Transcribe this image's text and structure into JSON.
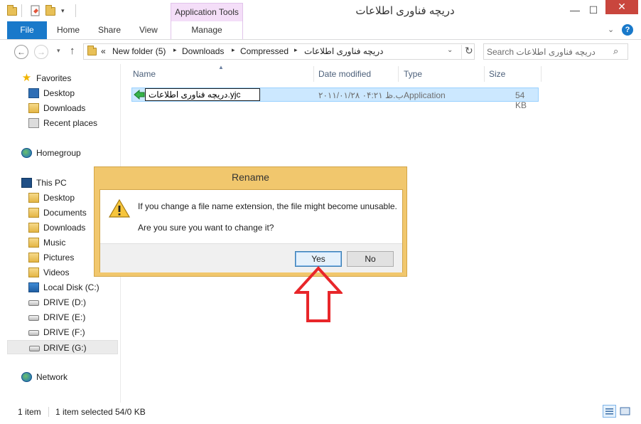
{
  "window": {
    "title": "دریچه فناوری اطلاعات",
    "contextual_tab": "Application Tools"
  },
  "ribbon": {
    "tabs": [
      "File",
      "Home",
      "Share",
      "View",
      "Manage"
    ]
  },
  "address": {
    "overflow": "«",
    "crumbs": [
      "New folder (5)",
      "Downloads",
      "Compressed",
      "دریچه فناوری اطلاعات"
    ],
    "search_placeholder": "Search دریچه فناوری اطلاعات"
  },
  "nav": {
    "favorites": "Favorites",
    "fav_items": [
      "Desktop",
      "Downloads",
      "Recent places"
    ],
    "homegroup": "Homegroup",
    "this_pc": "This PC",
    "pc_items": [
      "Desktop",
      "Documents",
      "Downloads",
      "Music",
      "Pictures",
      "Videos",
      "Local Disk (C:)",
      "DRIVE (D:)",
      "DRIVE (E:)",
      "DRIVE (F:)",
      "DRIVE (G:)"
    ],
    "network": "Network"
  },
  "columns": [
    "Name",
    "Date modified",
    "Type",
    "Size"
  ],
  "file": {
    "rename_value": "دریچه فناوری اطلاعات.yjc",
    "date_modified": "۲۰۱۱/۰۱/۲۸ ب.ظ ۰۴:۲۱",
    "type": "Application",
    "size": "54 KB"
  },
  "status": {
    "count": "1 item",
    "selection": "1 item selected",
    "size": "54/0 KB"
  },
  "dialog": {
    "title": "Rename",
    "message1": "If you change a file name extension, the file might become unusable.",
    "message2": "Are you sure you want to change it?",
    "yes": "Yes",
    "no": "No"
  },
  "colors": {
    "file_tab": "#1979ca",
    "contextual_tab": "#f4def8",
    "dialog_frame": "#f1c76d",
    "selection": "#cce8ff",
    "annotation_arrow": "#e8262a"
  }
}
